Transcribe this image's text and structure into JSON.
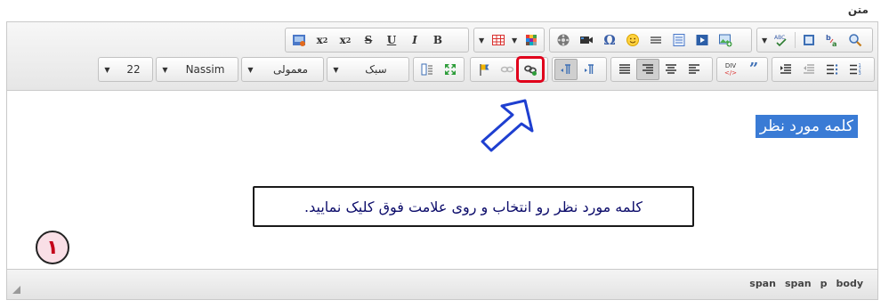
{
  "field_label": "متن",
  "toolbar": {
    "font_size": "22",
    "font_name": "Nassim",
    "format": "معمولی",
    "styles": "سبک",
    "source_label": "DIV",
    "icons": {
      "spellcheck": "spellcheck-icon",
      "find": "find-icon",
      "replace": "replace-icon",
      "select_all": "select-all-icon"
    }
  },
  "content": {
    "selected_word": "کلمه مورد نظر",
    "callout_text": "کلمه مورد نظر رو انتخاب و روی علامت فوق کلیک نمایید.",
    "step_number": "۱"
  },
  "statusbar": {
    "path": [
      "body",
      "p",
      "span",
      "span"
    ]
  },
  "colors": {
    "highlight_border": "#e0001b",
    "arrow": "#1e3fd0",
    "selection": "#3a7bd5"
  }
}
